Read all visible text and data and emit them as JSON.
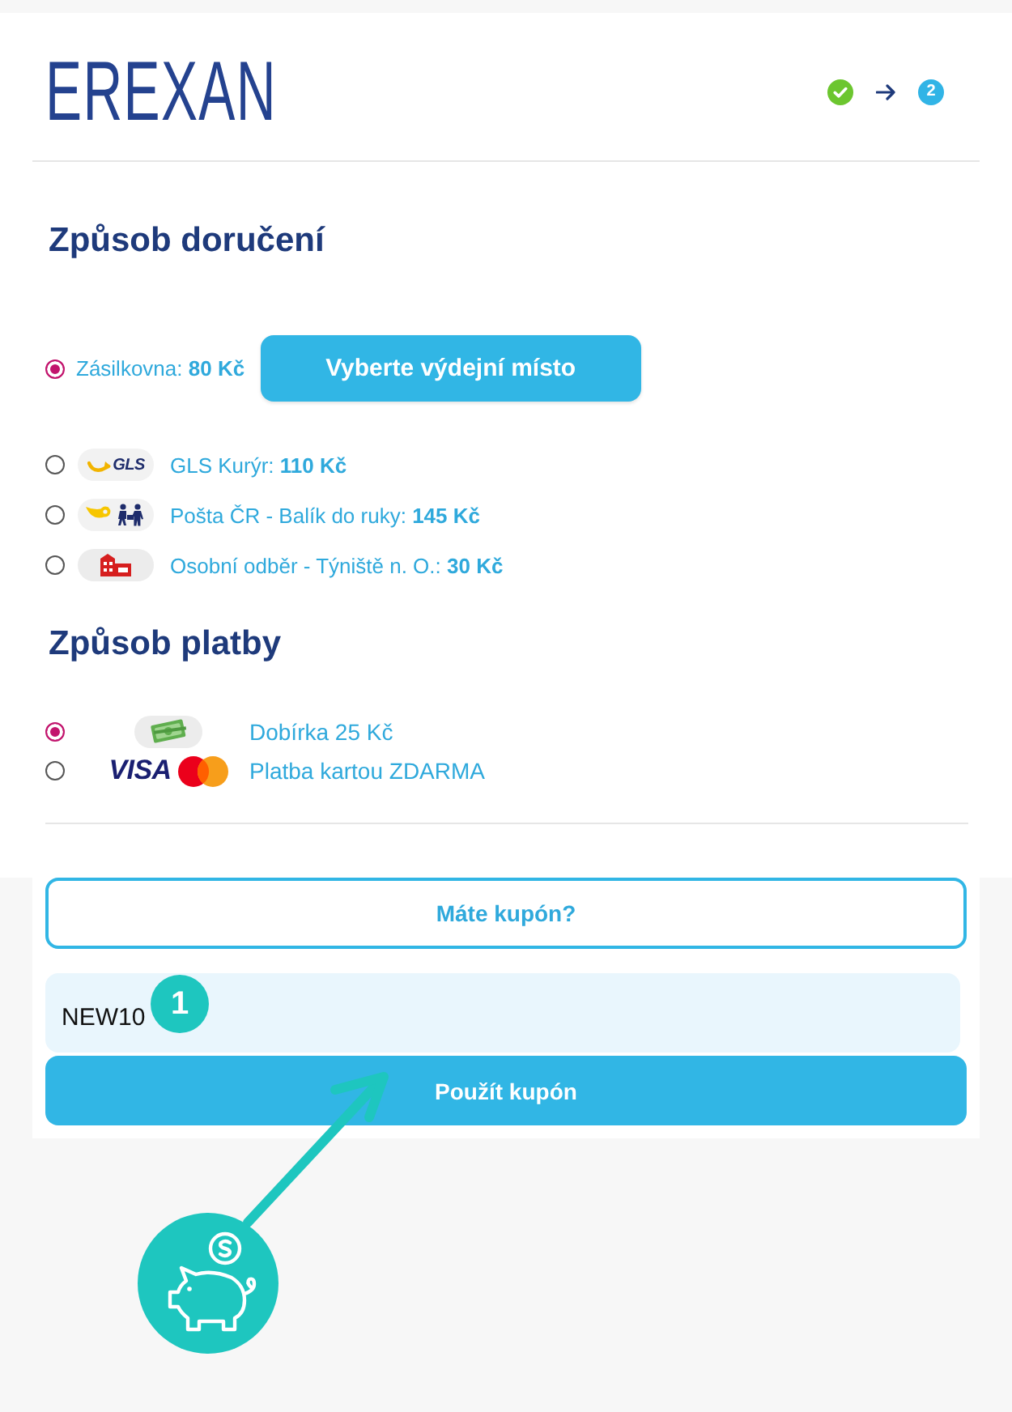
{
  "header": {
    "logo": "EREXAN",
    "steps": [
      {
        "done": true
      },
      {
        "done": false,
        "number": "2"
      }
    ]
  },
  "delivery": {
    "title": "Způsob doručení",
    "options": [
      {
        "label": "Zásilkovna: **80 Kč**",
        "selected": true,
        "action": "Vyberte výdejní místo"
      },
      {
        "logo": {
          "kind": "gls",
          "text": "GLS"
        },
        "label": "GLS Kurýr: **110 Kč**",
        "selected": false
      },
      {
        "logo": {
          "kind": "post"
        },
        "label": "Pošta ČR - Balík do ruky: **145 Kč**",
        "selected": false
      },
      {
        "logo": {
          "kind": "store"
        },
        "label": "Osobní odběr - Týniště n. O.: **30 Kč**",
        "selected": false
      }
    ]
  },
  "payment": {
    "title": "Způsob platby",
    "options": [
      {
        "kind": "cash",
        "label": "Dobírka 25 Kč",
        "selected": true
      },
      {
        "kind": "card",
        "brand_text": "VISA",
        "label": "Platba kartou ZDARMA",
        "selected": false
      }
    ]
  },
  "coupon": {
    "toggle": "Máte kupón?",
    "field": {
      "value": "NEW10"
    },
    "apply": "Použít kupón"
  },
  "annotation": {
    "badge": "1"
  }
}
